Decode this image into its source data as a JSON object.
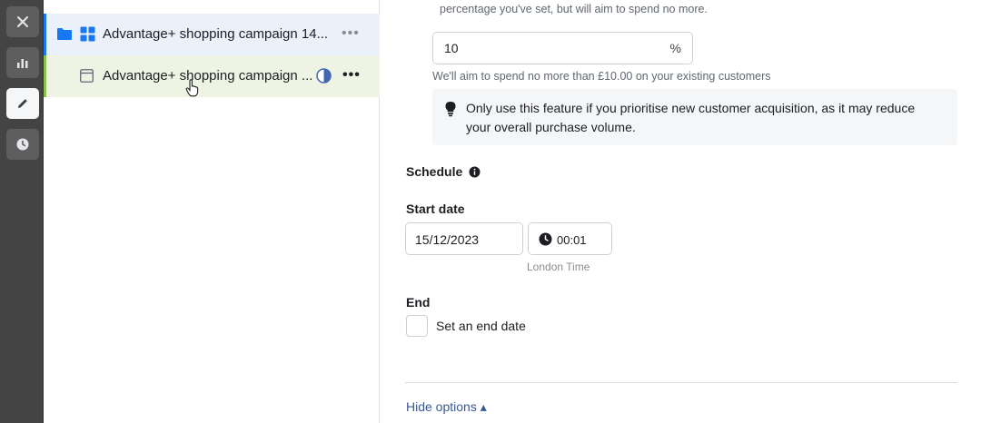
{
  "rail": {
    "items": [
      "close-icon",
      "chart-icon",
      "pencil-icon",
      "clock-icon"
    ],
    "active": "pencil-icon"
  },
  "tree": {
    "campaign": {
      "label": "Advantage+ shopping campaign 14...",
      "more": "•••"
    },
    "ad": {
      "label": "Advantage+ shopping campaign ...",
      "more": "•••"
    }
  },
  "budget": {
    "top_text": "percentage you've set, but will aim to spend no more.",
    "percent_value": "10",
    "percent_unit": "%",
    "helper": "We'll aim to spend no more than £10.00 on your existing customers",
    "tip": "Only use this feature if you prioritise new customer acquisition, as it may reduce your overall purchase volume."
  },
  "schedule": {
    "heading": "Schedule",
    "start_heading": "Start date",
    "start_date": "15/12/2023",
    "start_time": "00:01",
    "timezone": "London Time",
    "end_heading": "End",
    "end_checkbox_label": "Set an end date"
  },
  "footer": {
    "hide_options": "Hide options ▴"
  },
  "colors": {
    "accent": "#1877f2",
    "rail_bg": "#444444",
    "selected_row": "#ebf1fb",
    "hover_row": "#eef3e4"
  }
}
